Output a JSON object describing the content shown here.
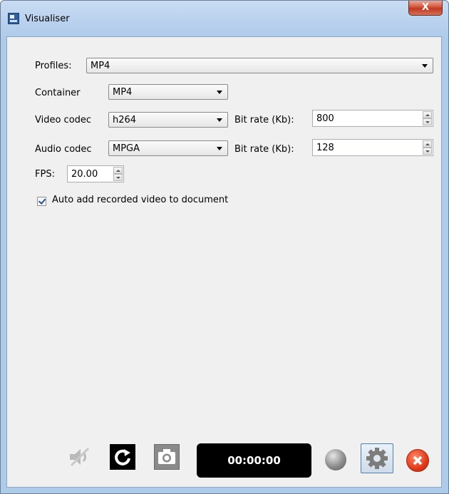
{
  "window": {
    "title": "Visualiser",
    "close_glyph": "X"
  },
  "form": {
    "profiles": {
      "label": "Profiles:",
      "value": "MP4"
    },
    "container": {
      "label": "Container",
      "value": "MP4"
    },
    "video": {
      "label": "Video codec",
      "value": "h264",
      "bitrate_label": "Bit rate (Kb):",
      "bitrate_value": "800"
    },
    "audio": {
      "label": "Audio codec",
      "value": "MPGA",
      "bitrate_label": "Bit rate (Kb):",
      "bitrate_value": "128"
    },
    "fps": {
      "label": "FPS:",
      "value": "20.00"
    },
    "auto_add": {
      "label": "Auto add recorded video to document",
      "checked": true
    }
  },
  "toolbar": {
    "timer": "00:00:00",
    "icons": [
      "mute-icon",
      "reload-icon",
      "camera-icon",
      "record-indicator",
      "gear-icon",
      "close-icon"
    ]
  },
  "colors": {
    "close_red": "#e03a1a",
    "titlebar_blue": "#b9d1ee",
    "client_bg": "#f0f0f0"
  }
}
